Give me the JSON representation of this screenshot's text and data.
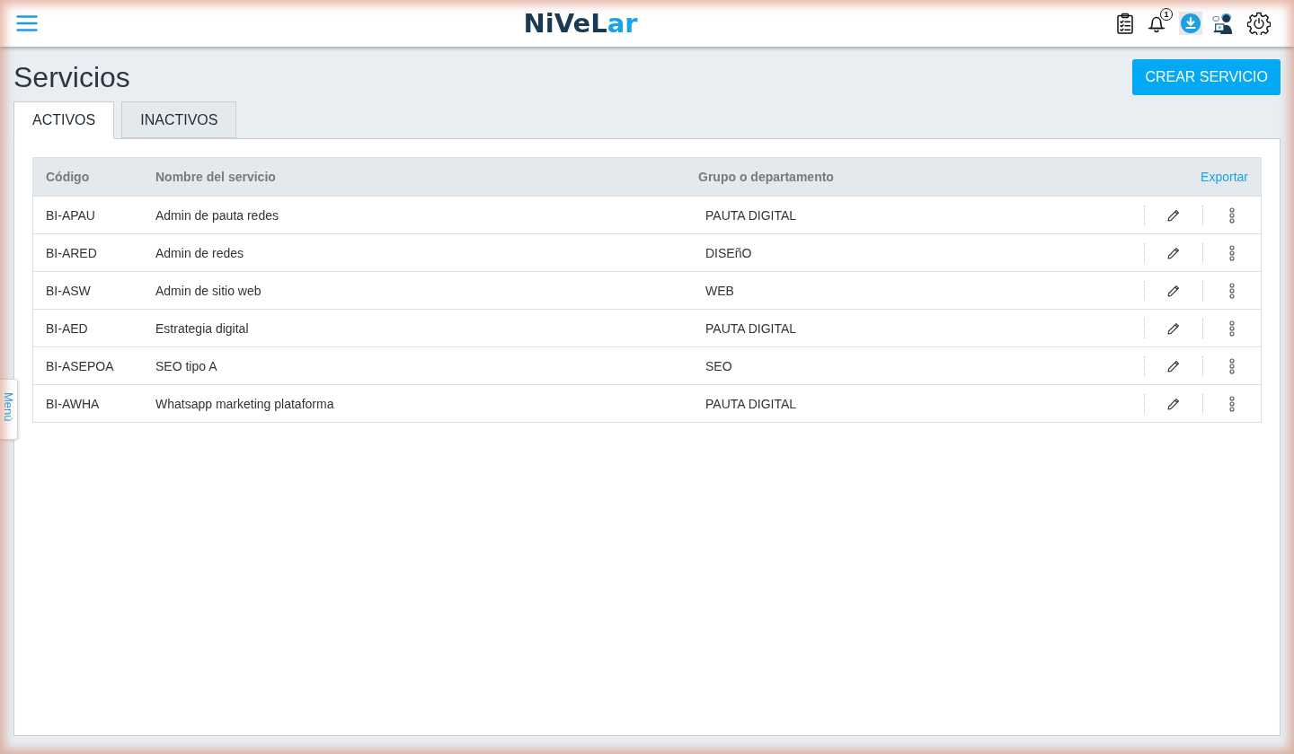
{
  "header": {
    "logo": {
      "dark": "NiVeL",
      "accent": "ar"
    },
    "notification_count": "1"
  },
  "page": {
    "title": "Servicios",
    "create_button": "CREAR SERVICIO"
  },
  "tabs": [
    {
      "label": "ACTIVOS",
      "selected": true
    },
    {
      "label": "INACTIVOS",
      "selected": false
    }
  ],
  "table": {
    "columns": [
      "Código",
      "Nombre del servicio",
      "Grupo o departamento"
    ],
    "export_link": "Exportar",
    "rows": [
      {
        "code": "BI-APAU",
        "name": "Admin de pauta redes",
        "group": "PAUTA DIGITAL"
      },
      {
        "code": "BI-ARED",
        "name": "Admin de redes",
        "group": "DISEñO"
      },
      {
        "code": "BI-ASW",
        "name": "Admin de sitio web",
        "group": "WEB"
      },
      {
        "code": "BI-AED",
        "name": "Estrategia digital",
        "group": "PAUTA DIGITAL"
      },
      {
        "code": "BI-ASEPOA",
        "name": "SEO tipo A",
        "group": "SEO"
      },
      {
        "code": "BI-AWHA",
        "name": "Whatsapp marketing plataforma",
        "group": "PAUTA DIGITAL"
      }
    ]
  },
  "side_tab": {
    "label": "Menú"
  }
}
